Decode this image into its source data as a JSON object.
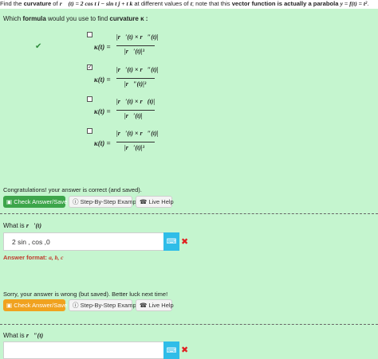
{
  "header": {
    "p1": "Find the ",
    "bold1": "curvature",
    "p2": " of ",
    "vec_r": "r⃗ (t) = 2 cos t i − sin t j + t k",
    "p3": " at different values of ",
    "t": "t",
    "p4": "; note that this ",
    "bold2": "vector function is actually a parabola",
    "p5": " ",
    "eq": "y = f(t) = t²",
    "p6": "."
  },
  "question1": {
    "pre": "Which ",
    "bold": "formula",
    "mid": " would you use to find ",
    "bold2": "curvature κ :",
    "options": [
      {
        "checked": false,
        "lhs": "κ(t) =",
        "num": "|r⃗′(t) × r⃗″(t)|",
        "den": "|r⃗′(t)|³"
      },
      {
        "checked": true,
        "lhs": "κ(t) =",
        "num": "|r⃗′(t) × r⃗″(t)|",
        "den": "|r⃗″(t)|³"
      },
      {
        "checked": false,
        "lhs": "κ(t) =",
        "num": "|r⃗′(t) × r⃗(t)|",
        "den": "|r⃗′(t)|"
      },
      {
        "checked": false,
        "lhs": "κ(t) =",
        "num": "|r⃗′(t) × r⃗″(t)|",
        "den": "|r⃗′(t)|³"
      }
    ],
    "check_mark": "✔"
  },
  "feedback1": "Congratulations! your answer is correct (and saved).",
  "buttons1": {
    "check": "Check Answer/Save",
    "example": "Step-By-Step Example",
    "help": "Live Help"
  },
  "question2": {
    "label": "What is ",
    "expr": "r⃗′(t)",
    "input_value": "2 sin , cos ,0",
    "format_label": "Answer format: ",
    "format_value": "a, b, c"
  },
  "feedback2": "Sorry, your answer is wrong (but saved). Better luck next time!",
  "buttons2": {
    "check": "Check Answer/Save",
    "example": "Step-By-Step Example",
    "help": "Live Help"
  },
  "question3": {
    "label": "What is ",
    "expr": "r⃗″(t)"
  },
  "icons": {
    "keyboard": "⌨",
    "wrong": "✖",
    "save": "💾",
    "info": "ⓘ",
    "phone": "☎"
  },
  "colors": {
    "bg": "#c5f5cf",
    "green": "#3ca54a",
    "orange": "#f0a21f",
    "blue": "#2fbde8",
    "red": "#e02020"
  }
}
